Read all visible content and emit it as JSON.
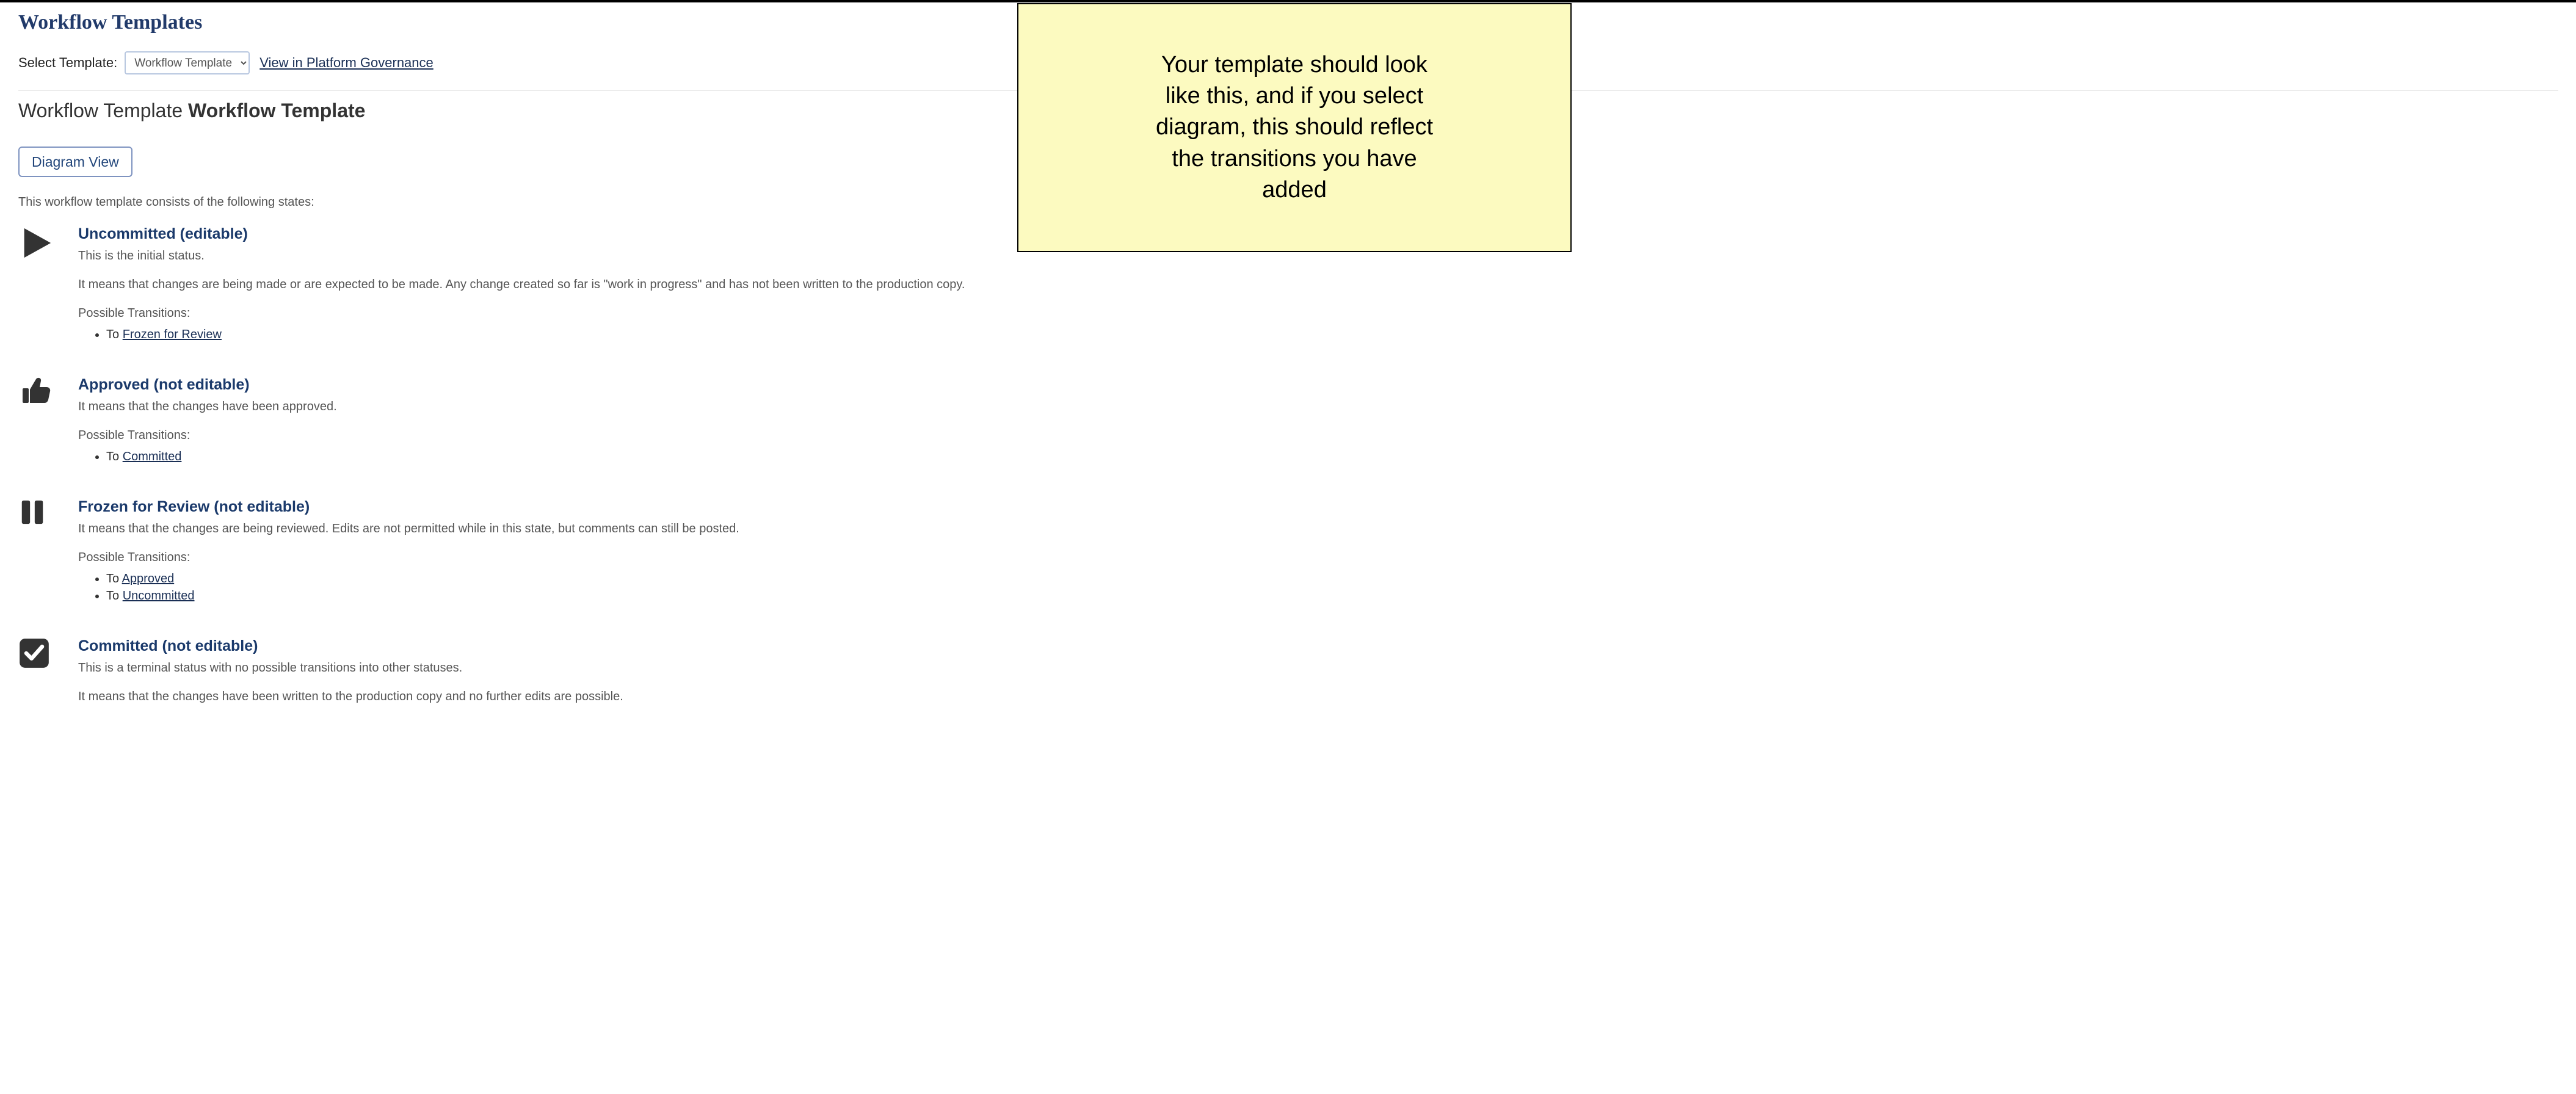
{
  "page": {
    "title": "Workflow Templates",
    "select_label": "Select Template:",
    "selected_value": "Workflow Template",
    "gov_link": "View in Platform Governance",
    "subtitle_prefix": "Workflow Template ",
    "subtitle_name": "Workflow Template",
    "diagram_btn": "Diagram View",
    "states_intro": "This workflow template consists of the following states:",
    "transition_to_prefix": "To "
  },
  "annotation": "Your template should look\nlike this, and if you select\ndiagram, this should reflect\nthe transitions you have\nadded",
  "states": [
    {
      "icon": "play",
      "title": "Uncommitted (editable)",
      "sub": "This is the initial status.",
      "desc": "It means that changes are being made or are expected to be made. Any change created so far is \"work in progress\" and has not been written to the production copy.",
      "trans_head": "Possible Transitions:",
      "transitions": [
        "Frozen for Review"
      ]
    },
    {
      "icon": "thumb",
      "title": "Approved (not editable)",
      "sub": "",
      "desc": "It means that the changes have been approved.",
      "trans_head": "Possible Transitions:",
      "transitions": [
        "Committed"
      ]
    },
    {
      "icon": "pause",
      "title": "Frozen for Review (not editable)",
      "sub": "",
      "desc": "It means that the changes are being reviewed. Edits are not permitted while in this state, but comments can still be posted.",
      "trans_head": "Possible Transitions:",
      "transitions": [
        "Approved",
        "Uncommitted"
      ]
    },
    {
      "icon": "check",
      "title": "Committed (not editable)",
      "sub": "This is a terminal status with no possible transitions into other statuses.",
      "desc": "It means that the changes have been written to the production copy and no further edits are possible.",
      "trans_head": "",
      "transitions": []
    }
  ]
}
